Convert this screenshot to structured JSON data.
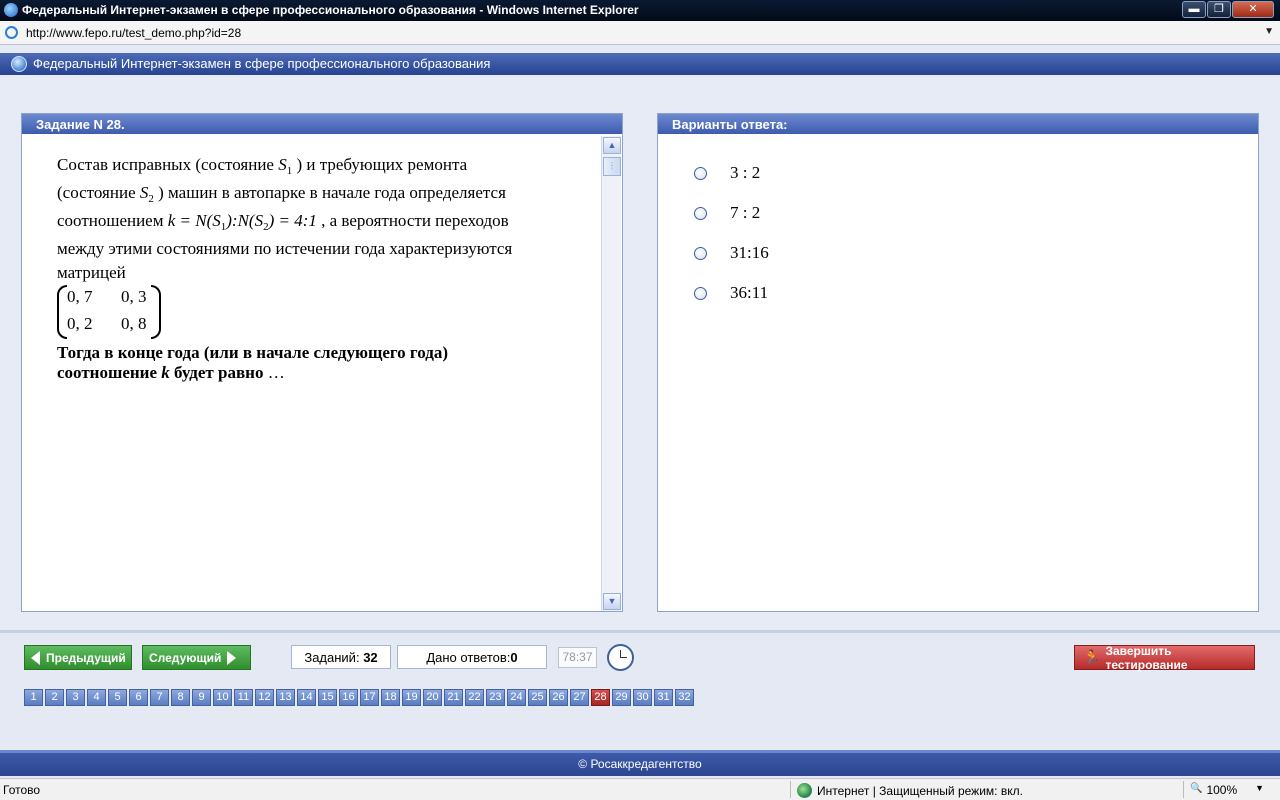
{
  "window": {
    "title": "Федеральный Интернет-экзамен в сфере профессионального образования - Windows Internet Explorer",
    "minimize": "▬",
    "maximize": "❐",
    "close": "✕"
  },
  "address": {
    "url": "http://www.fepo.ru/test_demo.php?id=28",
    "dropdown": "▼"
  },
  "header": {
    "title": "Федеральный Интернет-экзамен в сфере профессионального образования"
  },
  "question": {
    "heading": "Задание N 28.",
    "line1_a": "Состав исправных (состояние ",
    "line1_b": ") и требующих ремонта",
    "line2_a": "(состояние ",
    "line2_b": ") машин в автопарке в начале года определяется",
    "line3_a": "соотношением ",
    "line3_b": ", а вероятности переходов",
    "line4": "между этими состояниями по истечении года характеризуются",
    "line5": "матрицей",
    "s_letter": "S",
    "s1_sub": "1",
    "s2_sub": "2",
    "ratio_a": "k = N(S",
    "ratio_b": "):N(S",
    "ratio_c": ") = 4:1",
    "matrix": [
      [
        "0, 7",
        "0, 3"
      ],
      [
        "0, 2",
        "0, 8"
      ]
    ],
    "bold_line1": "Тогда в конце года (или в начале следующего года)",
    "bold_line2_a": "соотношение ",
    "bold_line2_k": "k",
    "bold_line2_b": " будет равно ",
    "ellipsis": "…",
    "scroll_up": "▲",
    "scroll_down": "▼",
    "scroll_grip": "⋮"
  },
  "answers": {
    "heading": "Варианты ответа:",
    "options": [
      "3 : 2",
      "7 : 2",
      "31:16",
      "36:11"
    ]
  },
  "navigation": {
    "prev_label": "Предыдущий",
    "next_label": "Следующий",
    "tasks_label": "Заданий: ",
    "tasks_count": "32",
    "answered_label": "Дано ответов:",
    "answered_count": "0",
    "timer": "78:37",
    "finish_label": "Завершить тестирование",
    "finish_icon": "🏃",
    "current_question": "28",
    "question_numbers": [
      "1",
      "2",
      "3",
      "4",
      "5",
      "6",
      "7",
      "8",
      "9",
      "10",
      "11",
      "12",
      "13",
      "14",
      "15",
      "16",
      "17",
      "18",
      "19",
      "20",
      "21",
      "22",
      "23",
      "24",
      "25",
      "26",
      "27",
      "28",
      "29",
      "30",
      "31",
      "32"
    ]
  },
  "footer": {
    "text": "© Росаккредагентство"
  },
  "status": {
    "ready": "Готово",
    "zone": "Интернет | Защищенный режим: вкл.",
    "zoom": "100%",
    "zoom_icon": "🔍",
    "zoom_arrow": "▼"
  }
}
